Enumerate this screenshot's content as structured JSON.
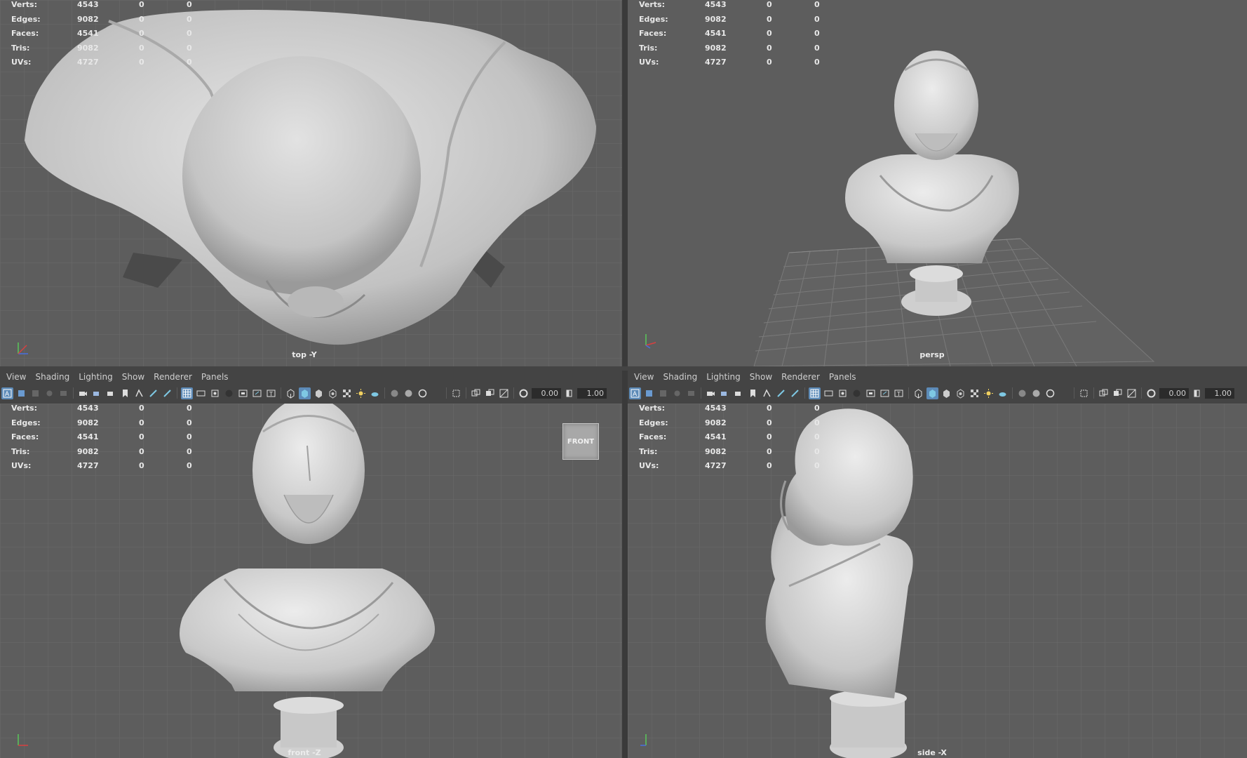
{
  "hud": {
    "rows": [
      {
        "label": "Verts:",
        "a": "4543",
        "b": "0",
        "c": "0"
      },
      {
        "label": "Edges:",
        "a": "9082",
        "b": "0",
        "c": "0"
      },
      {
        "label": "Faces:",
        "a": "4541",
        "b": "0",
        "c": "0"
      },
      {
        "label": "Tris:",
        "a": "9082",
        "b": "0",
        "c": "0"
      },
      {
        "label": "UVs:",
        "a": "4727",
        "b": "0",
        "c": "0"
      }
    ]
  },
  "viewports": {
    "top": {
      "camera": "top -Y"
    },
    "persp": {
      "camera": "persp"
    },
    "front": {
      "camera": "front -Z",
      "view_cube": "FRONT"
    },
    "side": {
      "camera": "side -X"
    }
  },
  "menu": {
    "view": "View",
    "shading": "Shading",
    "lighting": "Lighting",
    "show": "Show",
    "renderer": "Renderer",
    "panels": "Panels"
  },
  "toolbar": {
    "exposure": "0.00",
    "gamma": "1.00"
  },
  "colors": {
    "viewport_bg": "#5d5d5d",
    "grid": "#6c6c6c",
    "model": "#c9c9c9",
    "toolbar_active": "#5d8bb8",
    "axis_x": "#d94040",
    "axis_y": "#5ac85a",
    "axis_z": "#4a6ee0"
  }
}
